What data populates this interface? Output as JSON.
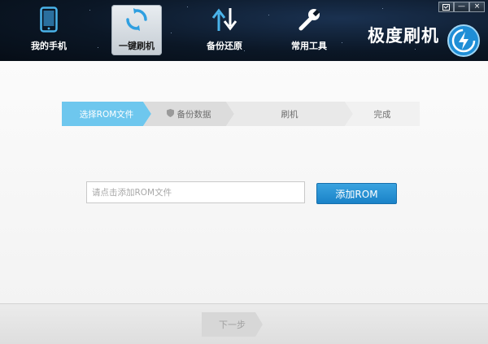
{
  "header": {
    "nav": [
      {
        "label": "我的手机",
        "icon": "phone-icon"
      },
      {
        "label": "一键刷机",
        "icon": "refresh-icon"
      },
      {
        "label": "备份还原",
        "icon": "backup-restore-icon"
      },
      {
        "label": "常用工具",
        "icon": "wrench-icon"
      }
    ],
    "active_nav": "一键刷机",
    "brand": "极度刷机",
    "window_controls": {
      "icon": "window-icon",
      "minimize": "—",
      "close": "×"
    }
  },
  "steps": [
    {
      "label": "选择ROM文件",
      "state": "active"
    },
    {
      "label": "备份数据",
      "state": "pending",
      "icon": "shield-icon"
    },
    {
      "label": "刷机",
      "state": "pending"
    },
    {
      "label": "完成",
      "state": "pending"
    }
  ],
  "rom_input": {
    "value": "",
    "placeholder": "请点击添加ROM文件"
  },
  "add_button": {
    "label": "添加ROM"
  },
  "footer": {
    "next_label": "下一步",
    "next_enabled": false
  },
  "colors": {
    "header_bg": "#0b1726",
    "step_active": "#6ec7ee",
    "button_blue": "#1a82c8",
    "logo_blue": "#1f8ed6"
  }
}
